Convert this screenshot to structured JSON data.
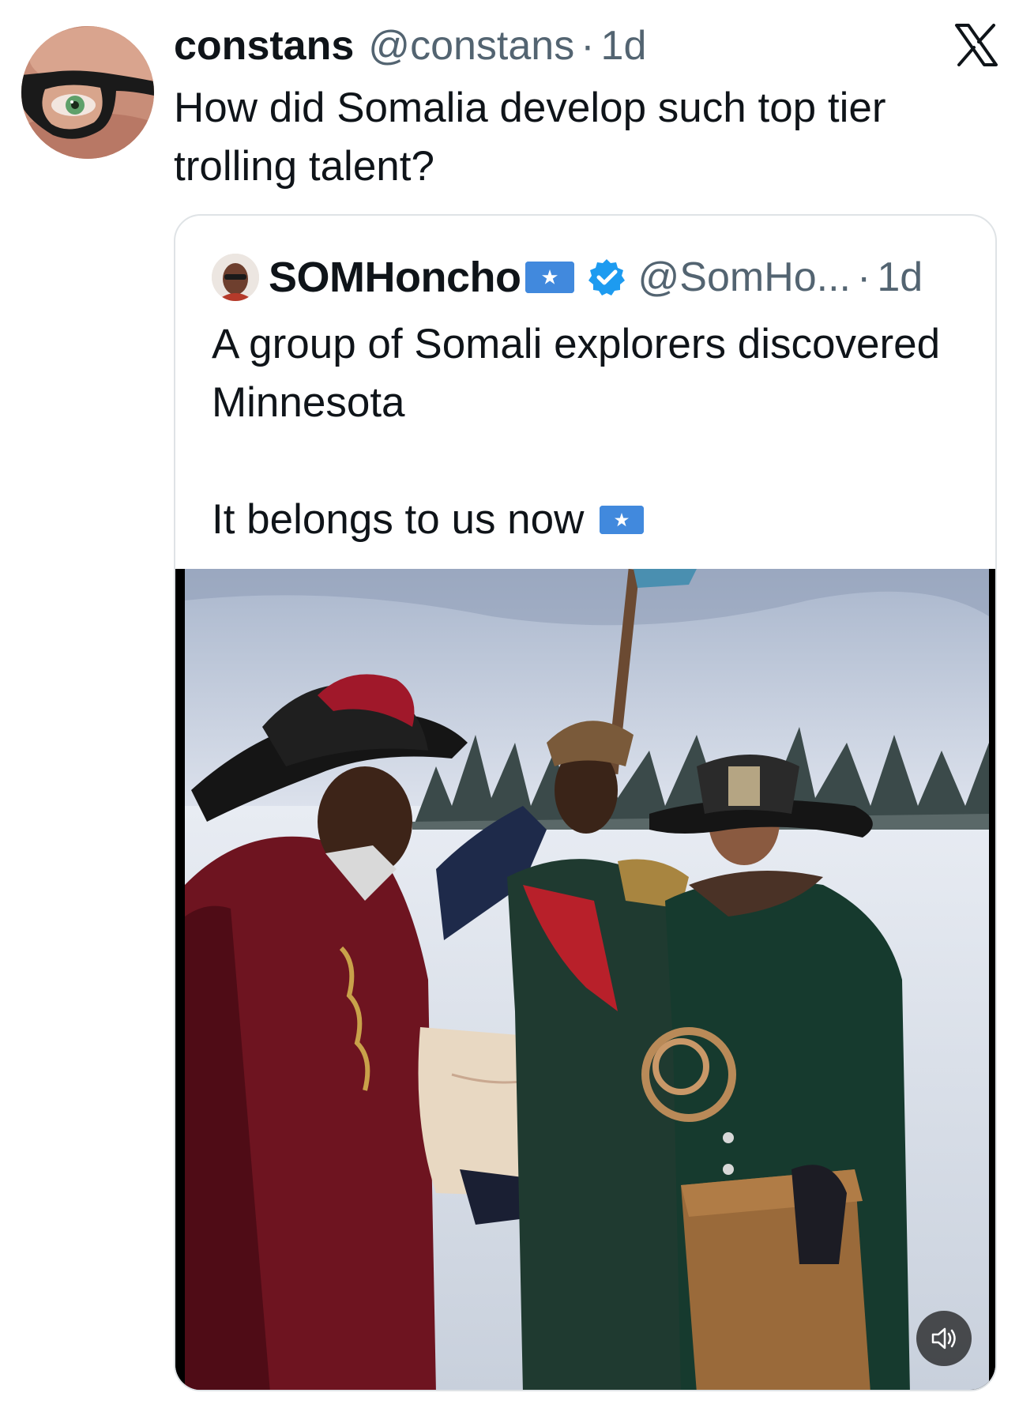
{
  "tweet": {
    "author_name": "constans",
    "author_handle": "@constans",
    "separator": "·",
    "time": "1d",
    "text": "How did Somalia develop such top tier trolling talent?"
  },
  "quoted_tweet": {
    "author_name": "SOMHoncho",
    "author_handle": "@SomHo...",
    "separator": "·",
    "time": "1d",
    "text_line1": "A group of Somali explorers discovered Minnesota",
    "text_line2": "It belongs to us now",
    "verified": true
  },
  "icons": {
    "platform_logo": "x-logo-icon",
    "verified": "verified-badge-icon",
    "flag": "somalia-flag-icon",
    "sound": "volume-icon"
  },
  "colors": {
    "text_primary": "#0f1419",
    "text_secondary": "#536471",
    "verified_blue": "#1d9bf0",
    "somalia_flag_blue": "#4189dd",
    "card_border": "#dfe3e6"
  }
}
